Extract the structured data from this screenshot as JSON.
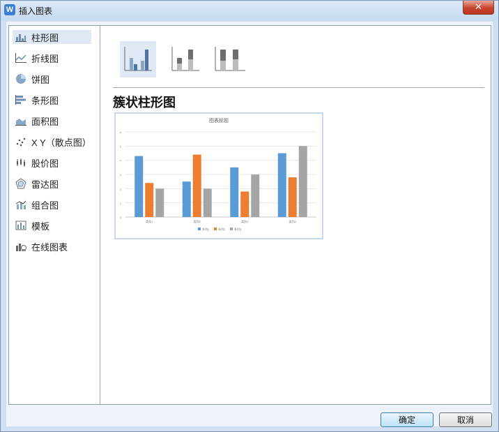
{
  "window": {
    "title": "插入图表",
    "close_label": "✕",
    "app_icon_letter": "W"
  },
  "sidebar": {
    "items": [
      {
        "label": "柱形图",
        "icon": "bar-chart-icon",
        "selected": true
      },
      {
        "label": "折线图",
        "icon": "line-chart-icon"
      },
      {
        "label": "饼图",
        "icon": "pie-chart-icon"
      },
      {
        "label": "条形图",
        "icon": "horizontal-bar-icon"
      },
      {
        "label": "面积图",
        "icon": "area-chart-icon"
      },
      {
        "label": "X Y（散点图）",
        "icon": "scatter-chart-icon"
      },
      {
        "label": "股价图",
        "icon": "stock-chart-icon"
      },
      {
        "label": "雷达图",
        "icon": "radar-chart-icon"
      },
      {
        "label": "组合图",
        "icon": "combo-chart-icon"
      },
      {
        "label": "模板",
        "icon": "template-icon"
      },
      {
        "label": "在线图表",
        "icon": "online-chart-icon"
      }
    ]
  },
  "main": {
    "subtypes": [
      "clustered-column",
      "stacked-column",
      "percent-stacked-column"
    ],
    "selected_subtype_title": "簇状柱形图"
  },
  "colors": {
    "series1": "#5b9bd5",
    "series2": "#ed7d31",
    "series3": "#a5a5a5"
  },
  "chart_data": {
    "type": "bar",
    "title": "图表标题",
    "categories": [
      "类别1",
      "类别2",
      "类别3",
      "类别4"
    ],
    "series": [
      {
        "name": "系列1",
        "values": [
          4.3,
          2.5,
          3.5,
          4.5
        ]
      },
      {
        "name": "系列2",
        "values": [
          2.4,
          4.4,
          1.8,
          2.8
        ]
      },
      {
        "name": "系列3",
        "values": [
          2,
          2,
          3,
          5
        ]
      }
    ],
    "ylim": [
      0,
      6
    ],
    "yticks": [
      0,
      1,
      2,
      3,
      4,
      5,
      6
    ],
    "grid": true,
    "legend": "bottom"
  },
  "buttons": {
    "ok": "确定",
    "cancel": "取消"
  }
}
